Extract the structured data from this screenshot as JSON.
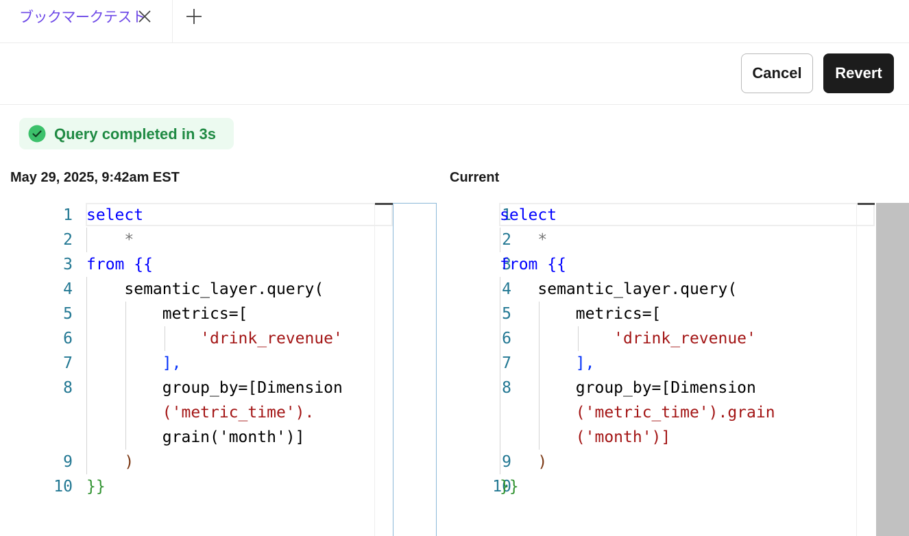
{
  "tab": {
    "label": "ブックマークテスト",
    "close_icon": "close-icon",
    "new_tab_icon": "plus-icon"
  },
  "toolbar": {
    "cancel_label": "Cancel",
    "revert_label": "Revert"
  },
  "status": {
    "icon": "check-circle-icon",
    "text": "Query completed in 3s",
    "color": "#1f8a43"
  },
  "panes": {
    "left": {
      "label": "May 29, 2025, 9:42am EST",
      "line_numbers": [
        "1",
        "2",
        "3",
        "4",
        "5",
        "6",
        "7",
        "8",
        "9",
        "10"
      ],
      "code": [
        "select",
        "    *",
        "from {{",
        "    semantic_layer.query(",
        "        metrics=[",
        "            'drink_revenue'",
        "        ],",
        "        group_by=[Dimension",
        "        ('metric_time').",
        "        grain('month')]",
        "    )",
        "}}"
      ]
    },
    "right": {
      "label": "Current",
      "line_numbers": [
        "1",
        "2",
        "3",
        "4",
        "5",
        "6",
        "7",
        "8",
        "9",
        "10"
      ],
      "code": [
        "select",
        "    *",
        "from {{",
        "    semantic_layer.query(",
        "        metrics=[",
        "            'drink_revenue'",
        "        ],",
        "        group_by=[Dimension",
        "        ('metric_time').grain",
        "        ('month')]",
        "    )",
        "}}"
      ]
    }
  },
  "colors": {
    "accent_tab": "#6d48e7",
    "keyword": "#0000ff",
    "string": "#a31515",
    "line_number": "#237893"
  }
}
